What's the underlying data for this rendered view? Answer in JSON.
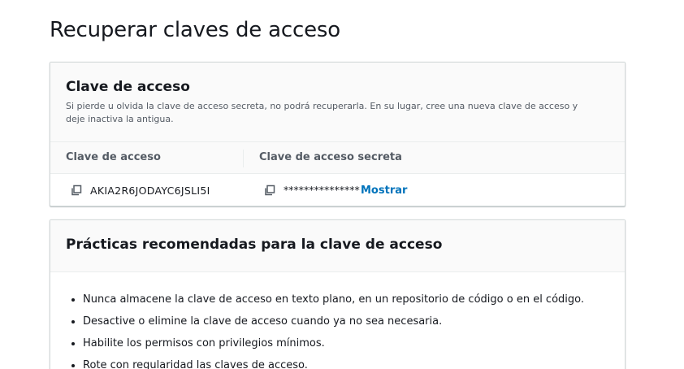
{
  "page": {
    "title": "Recuperar claves de acceso"
  },
  "access_key_card": {
    "title": "Clave de acceso",
    "description": "Si pierde u olvida la clave de acceso secreta, no podrá recuperarla. En su lugar, cree una nueva clave de acceso y deje inactiva la antigua.",
    "columns": [
      "Clave de acceso",
      "Clave de acceso secreta"
    ],
    "access_key_id": "AKIA2R6JODAYC6JSLI5I",
    "secret_masked": "***************",
    "show_label": "Mostrar",
    "link_color": "#0073bb"
  },
  "best_practices_card": {
    "title": "Prácticas recomendadas para la clave de acceso",
    "items": [
      "Nunca almacene la clave de acceso en texto plano, en un repositorio de código o en el código.",
      "Desactive o elimine la clave de acceso cuando ya no sea necesaria.",
      "Habilite los permisos con privilegios mínimos.",
      "Rote con regularidad las claves de acceso."
    ]
  }
}
